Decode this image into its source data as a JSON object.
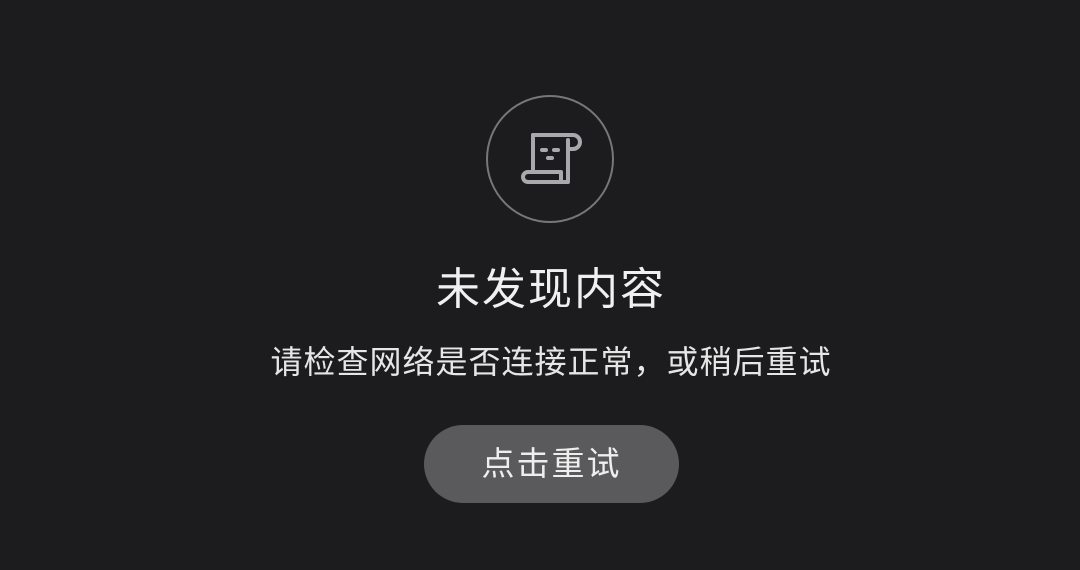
{
  "empty_state": {
    "icon": "scroll-document-icon",
    "title": "未发现内容",
    "message": "请检查网络是否连接正常，或稍后重试",
    "retry_label": "点击重试"
  },
  "colors": {
    "background": "#1c1c1e",
    "icon_outline": "#77777a",
    "text": "#f0f0f0",
    "button_background": "#5a5a5c"
  }
}
